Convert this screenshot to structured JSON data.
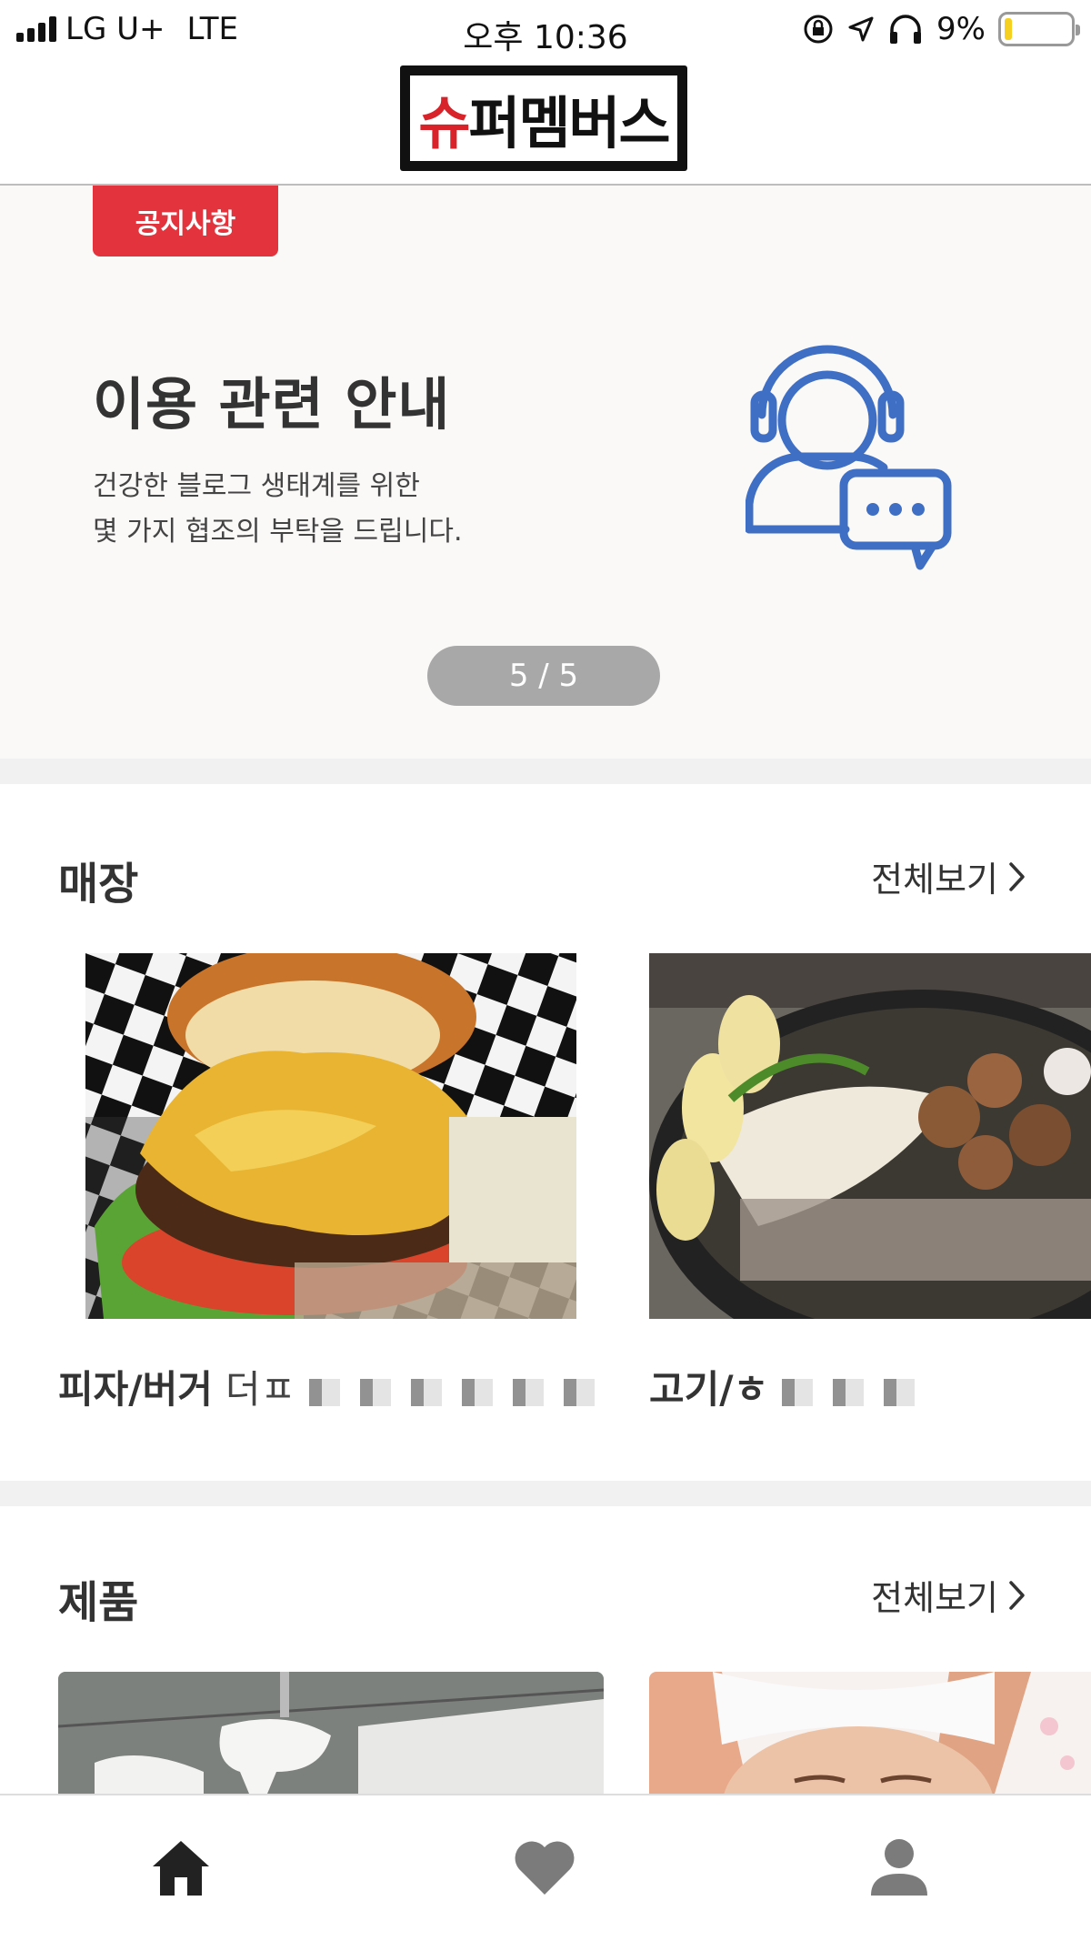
{
  "status_bar": {
    "carrier": "LG U+",
    "network": "LTE",
    "time": "오후 10:36",
    "battery": "9%"
  },
  "header": {
    "logo_text": "슈퍼멤버스"
  },
  "notice_banner": {
    "tag": "공지사항",
    "title": "이용 관련 안내",
    "description_line1": "건강한 블로그 생태계를 위한",
    "description_line2": "몇 가지 협조의 부탁을 드립니다.",
    "pager": "5 / 5",
    "illustration": "customer-support-headset-icon"
  },
  "stores_section": {
    "title": "매장",
    "see_all": "전체보기",
    "cards": [
      {
        "category": "피자/버거",
        "name": "더ㅍ",
        "image": "burger-photo"
      },
      {
        "category": "고기/ㅎ",
        "name": "",
        "image": "grilled-meat-photo"
      }
    ]
  },
  "products_section": {
    "title": "제품",
    "see_all": "전체보기",
    "cards": [
      {
        "image": "bathroom-photo"
      },
      {
        "image": "face-care-photo"
      }
    ]
  },
  "tab_bar": {
    "tabs": [
      {
        "icon": "home-icon",
        "active": true
      },
      {
        "icon": "heart-icon",
        "active": false
      },
      {
        "icon": "profile-icon",
        "active": false
      }
    ]
  },
  "colors": {
    "accent_red": "#e3333d",
    "illustration_blue": "#3f6fc4",
    "pager_gray": "#a8a8a8"
  }
}
